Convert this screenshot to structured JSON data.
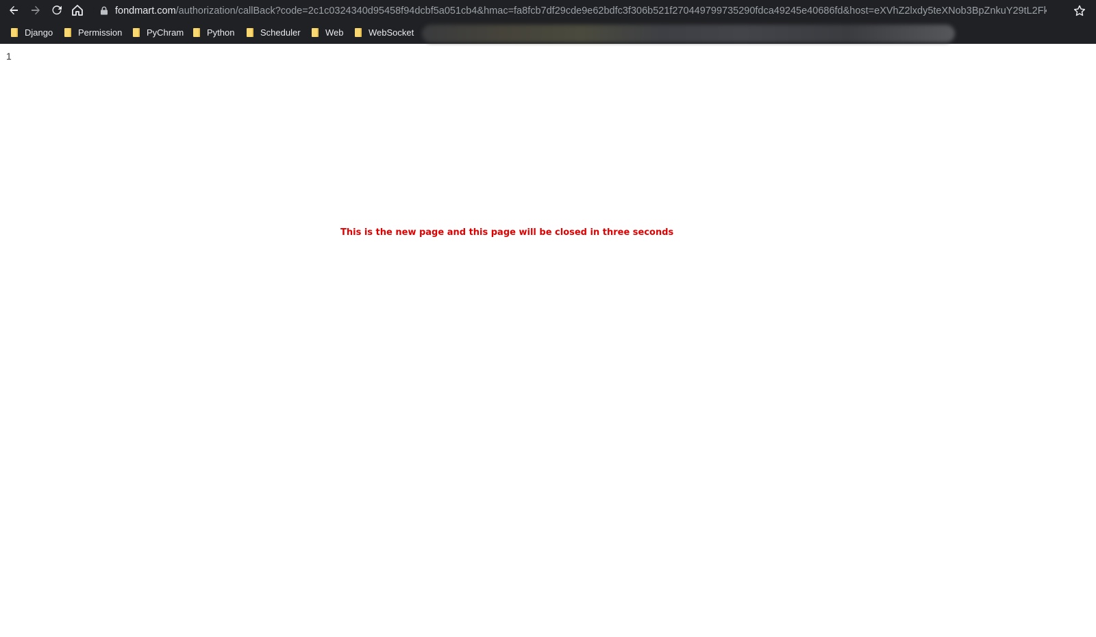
{
  "browser": {
    "url_host": "fondmart.com",
    "url_path": "/authorization/callBack?code=2c1c0324340d95458f94dcbf5a051cb4&hmac=fa8fcb7df29cde9e62bdfc3f306b521f270449799735290fdca49245e40686fd&host=eXVhZ2lxdy5teXNob3BpZnkuY29tL2Fk...",
    "bookmarks": [
      {
        "label": "Django"
      },
      {
        "label": "Permission"
      },
      {
        "label": "PyChram"
      },
      {
        "label": "Python"
      },
      {
        "label": "Scheduler"
      },
      {
        "label": "Web"
      },
      {
        "label": "WebSocket"
      }
    ]
  },
  "page": {
    "line_number": "1",
    "message": "This is the new page and this page will be closed in three seconds"
  },
  "colors": {
    "chrome_bg": "#202124",
    "message_red": "#e00000",
    "folder_yellow": "#f9d771"
  }
}
